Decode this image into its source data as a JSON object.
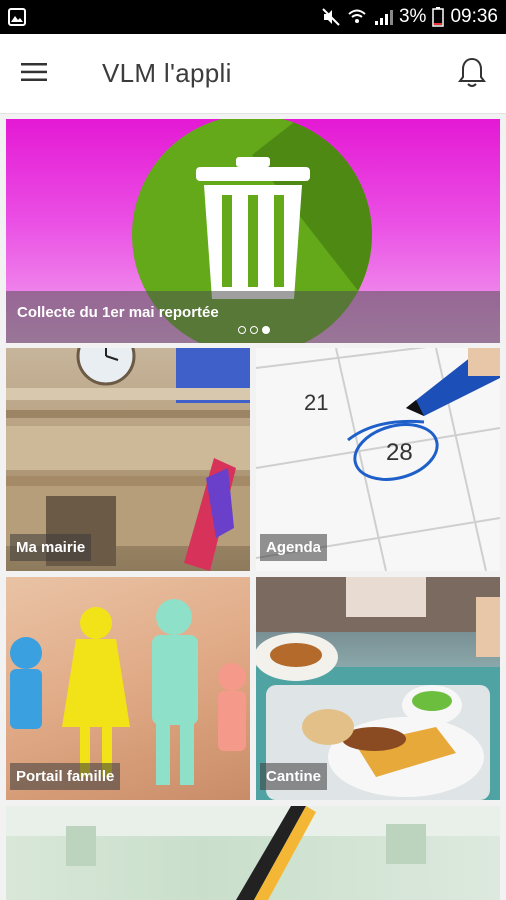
{
  "status_bar": {
    "battery": "3%",
    "time": "09:36",
    "icons": [
      "gallery-icon",
      "mute-icon",
      "wifi-icon",
      "signal-icon",
      "battery-icon"
    ]
  },
  "app_bar": {
    "title": "VLM l'appli",
    "icons": [
      "hamburger-menu-icon",
      "bell-icon"
    ]
  },
  "banner": {
    "caption": "Collecte du 1er mai reportée",
    "icon": "trash-can-icon",
    "dots_total": 3,
    "dots_active_index": 2,
    "colors": {
      "background_top": "#e419d4",
      "circle": "#63a91a"
    }
  },
  "tiles": [
    {
      "label": "Ma mairie"
    },
    {
      "label": "Agenda"
    },
    {
      "label": "Portail famille"
    },
    {
      "label": "Cantine"
    }
  ]
}
